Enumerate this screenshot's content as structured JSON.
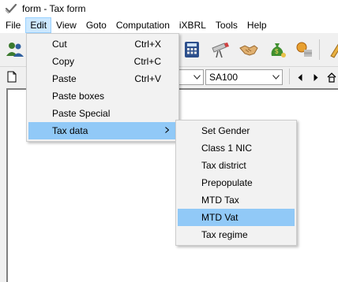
{
  "window": {
    "title": "form - Tax form"
  },
  "menubar": {
    "items": [
      "File",
      "Edit",
      "View",
      "Goto",
      "Computation",
      "iXBRL",
      "Tools",
      "Help"
    ],
    "active": "Edit"
  },
  "toolbar2": {
    "form_combo": "SA100"
  },
  "edit_menu": {
    "items": [
      {
        "label": "Cut",
        "shortcut": "Ctrl+X"
      },
      {
        "label": "Copy",
        "shortcut": "Ctrl+C"
      },
      {
        "label": "Paste",
        "shortcut": "Ctrl+V"
      },
      {
        "label": "Paste boxes",
        "shortcut": ""
      },
      {
        "label": "Paste Special",
        "shortcut": ""
      },
      {
        "label": "Tax data",
        "shortcut": "",
        "submenu": true
      }
    ]
  },
  "tax_data_submenu": {
    "items": [
      "Set Gender",
      "Class 1 NIC",
      "Tax district",
      "Prepopulate",
      "MTD Tax",
      "MTD Vat",
      "Tax regime"
    ],
    "highlighted": "MTD Vat"
  },
  "icons": {
    "app": "form-icon",
    "toolbar": [
      "users-icon",
      "calculator-icon",
      "telescope-icon",
      "handshake-icon",
      "money-bag-icon",
      "coins-icon",
      "pencil-icon"
    ]
  },
  "colors": {
    "menu_highlight": "#91c9f7",
    "menubar_active": "#cce8ff"
  }
}
